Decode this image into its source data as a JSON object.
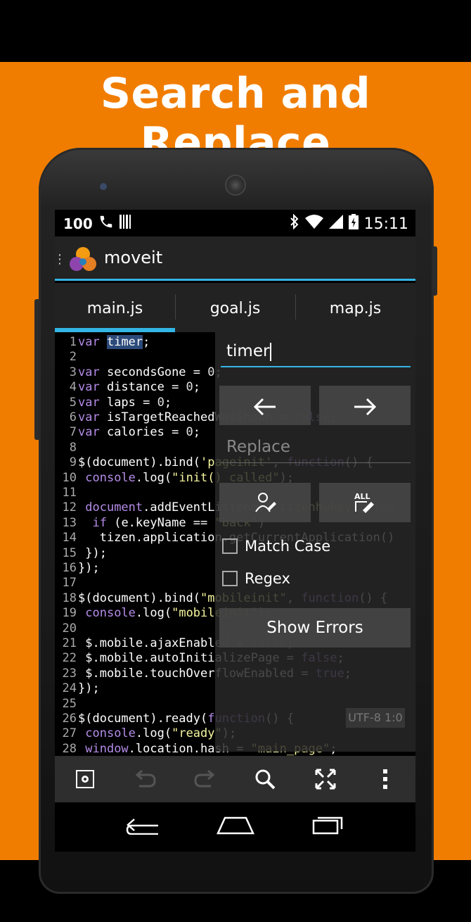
{
  "banner": {
    "title": "Search and Replace"
  },
  "statusbar": {
    "battery_level": "100",
    "time": "15:11"
  },
  "app": {
    "title": "moveit"
  },
  "tabs": [
    {
      "label": "main.js",
      "active": true
    },
    {
      "label": "goal.js",
      "active": false
    },
    {
      "label": "map.js",
      "active": false
    }
  ],
  "editor": {
    "lines": [
      {
        "n": "1",
        "html": "<span class=\"kw\">var</span> <span class=\"sel\">timer</span>;"
      },
      {
        "n": "2",
        "html": ""
      },
      {
        "n": "3",
        "html": "<span class=\"kw\">var</span> secondsGone = <span class=\"numc\">0</span>;"
      },
      {
        "n": "4",
        "html": "<span class=\"kw\">var</span> distance = <span class=\"numc\">0</span>;"
      },
      {
        "n": "5",
        "html": "<span class=\"kw\">var</span> laps = <span class=\"numc\">0</span>;"
      },
      {
        "n": "6",
        "html": "<span class=\"kw\">var</span> isTargetReachedWasShown = <span class=\"kw\">false</span>;"
      },
      {
        "n": "7",
        "html": "<span class=\"kw\">var</span> calories = <span class=\"numc\">0</span>;"
      },
      {
        "n": "8",
        "html": ""
      },
      {
        "n": "9",
        "html": "$(document).bind(<span class=\"str\">'pageinit'</span>, <span class=\"kw\">function</span>() {"
      },
      {
        "n": "10",
        "html": " <span class=\"kw\">console</span>.log(<span class=\"str\">\"init() called\"</span>);"
      },
      {
        "n": "11",
        "html": ""
      },
      {
        "n": "12",
        "html": " <span class=\"kw\">document</span>.addEventListener(<span class=\"str\">'tizenhwkey'</span>, <span class=\"kw\">fun</span>"
      },
      {
        "n": "13",
        "html": "  <span class=\"kw\">if</span> (e.keyName == <span class=\"str\">\"back\"</span>)"
      },
      {
        "n": "14",
        "html": "   tizen.application.getCurrentApplication()"
      },
      {
        "n": "15",
        "html": " });"
      },
      {
        "n": "16",
        "html": "});"
      },
      {
        "n": "17",
        "html": ""
      },
      {
        "n": "18",
        "html": "$(document).bind(<span class=\"str\">\"mobileinit\"</span>, <span class=\"kw\">function</span>() {"
      },
      {
        "n": "19",
        "html": " <span class=\"kw\">console</span>.log(<span class=\"str\">\"mobileinit\"</span>);"
      },
      {
        "n": "20",
        "html": ""
      },
      {
        "n": "21",
        "html": " $.mobile.ajaxEnabled = <span class=\"kw\">false</span>;"
      },
      {
        "n": "22",
        "html": " $.mobile.autoInitializePage = <span class=\"kw\">false</span>;"
      },
      {
        "n": "23",
        "html": " $.mobile.touchOverflowEnabled = <span class=\"kw\">true</span>;"
      },
      {
        "n": "24",
        "html": "});"
      },
      {
        "n": "25",
        "html": ""
      },
      {
        "n": "26",
        "html": "$(document).ready(<span class=\"kw\">function</span>() {"
      },
      {
        "n": "27",
        "html": " <span class=\"kw\">console</span>.log(<span class=\"str\">\"ready\"</span>);"
      },
      {
        "n": "28",
        "html": " <span class=\"kw\">window</span>.location.hash = <span class=\"str\">\"main_page\"</span>;"
      }
    ]
  },
  "find": {
    "search_value": "timer",
    "prev_icon": "arrow-left-icon",
    "next_icon": "arrow-right-icon",
    "replace_placeholder": "Replace",
    "match_case_label": "Match Case",
    "regex_label": "Regex",
    "show_errors_label": "Show Errors",
    "encoding": "UTF-8 1:0"
  },
  "toolbar": {
    "icons": [
      "settings-icon",
      "undo-icon",
      "redo-icon",
      "search-icon",
      "fullscreen-icon",
      "overflow-menu-icon"
    ]
  },
  "navbar": {
    "icons": [
      "back-icon",
      "home-icon",
      "recents-icon"
    ]
  }
}
